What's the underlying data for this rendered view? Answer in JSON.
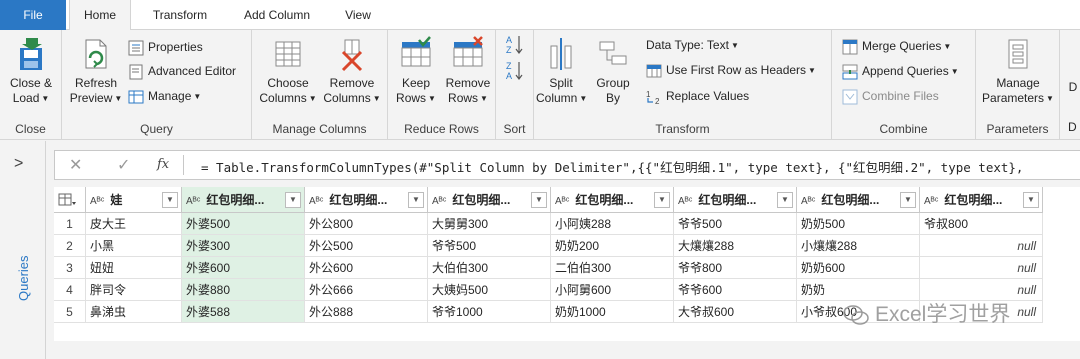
{
  "tabs": [
    "File",
    "Home",
    "Transform",
    "Add Column",
    "View"
  ],
  "ribbon": {
    "close": {
      "line1": "Close &",
      "line2": "Load",
      "group": "Close"
    },
    "query": {
      "refresh_line1": "Refresh",
      "refresh_line2": "Preview",
      "properties": "Properties",
      "advanced_editor": "Advanced Editor",
      "manage": "Manage",
      "group": "Query"
    },
    "manage_columns": {
      "choose_line1": "Choose",
      "choose_line2": "Columns",
      "remove_line1": "Remove",
      "remove_line2": "Columns",
      "group": "Manage Columns"
    },
    "reduce_rows": {
      "keep_line1": "Keep",
      "keep_line2": "Rows",
      "remove_line1": "Remove",
      "remove_line2": "Rows",
      "group": "Reduce Rows"
    },
    "sort": {
      "group": "Sort"
    },
    "transform": {
      "split_line1": "Split",
      "split_line2": "Column",
      "group_line1": "Group",
      "group_line2": "By",
      "data_type": "Data Type: Text",
      "first_row": "Use First Row as Headers",
      "replace": "Replace Values",
      "group": "Transform"
    },
    "combine": {
      "merge": "Merge Queries",
      "append": "Append Queries",
      "combine_files": "Combine Files",
      "group": "Combine"
    },
    "parameters": {
      "line1": "Manage",
      "line2": "Parameters",
      "group": "Parameters",
      "cut_label": "D",
      "cut_group": "D"
    }
  },
  "queries_pane": {
    "label": "Queries"
  },
  "formula": "= Table.TransformColumnTypes(#\"Split Column by Delimiter\",{{\"红包明细.1\", type text}, {\"红包明细.2\", type text},",
  "table": {
    "headers": [
      "娃",
      "红包明细...",
      "红包明细...",
      "红包明细...",
      "红包明细...",
      "红包明细...",
      "红包明细...",
      "红包明细..."
    ],
    "rows": [
      {
        "n": "1",
        "cells": [
          "皮大王",
          "外婆500",
          "外公800",
          "大舅舅300",
          "小阿姨288",
          "爷爷500",
          "奶奶500",
          "爷叔800"
        ]
      },
      {
        "n": "2",
        "cells": [
          "小黑",
          "外婆300",
          "外公500",
          "爷爷500",
          "奶奶200",
          "大爙爙288",
          "小爙爙288",
          "null"
        ]
      },
      {
        "n": "3",
        "cells": [
          "妞妞",
          "外婆600",
          "外公600",
          "大伯伯300",
          "二伯伯300",
          "爷爷800",
          "奶奶600",
          "null"
        ]
      },
      {
        "n": "4",
        "cells": [
          "胖司令",
          "外婆880",
          "外公666",
          "大姨妈500",
          "小阿舅600",
          "爷爷600",
          "奶奶",
          "null"
        ]
      },
      {
        "n": "5",
        "cells": [
          "鼻涕虫",
          "外婆588",
          "外公888",
          "爷爷1000",
          "奶奶1000",
          "大爷叔600",
          "小爷叔600",
          "null"
        ]
      }
    ]
  },
  "watermark": "Excel学习世界"
}
